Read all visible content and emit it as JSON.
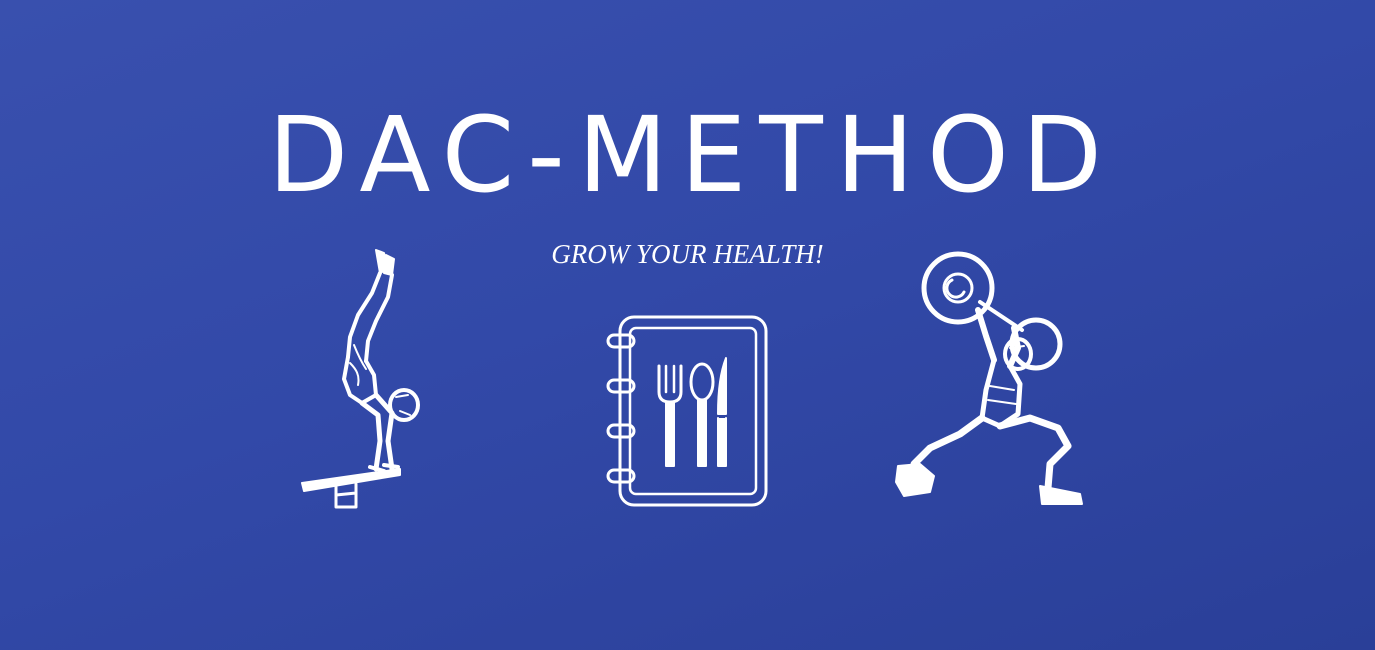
{
  "banner": {
    "title": "DAC-METHOD",
    "tagline": "GROW YOUR HEALTH!"
  },
  "colors": {
    "background": "#3249a8",
    "foreground": "#ffffff"
  },
  "illustrations": [
    {
      "icon": "handstand-gymnast-icon"
    },
    {
      "icon": "recipe-book-cutlery-icon"
    },
    {
      "icon": "weightlifter-icon"
    }
  ]
}
